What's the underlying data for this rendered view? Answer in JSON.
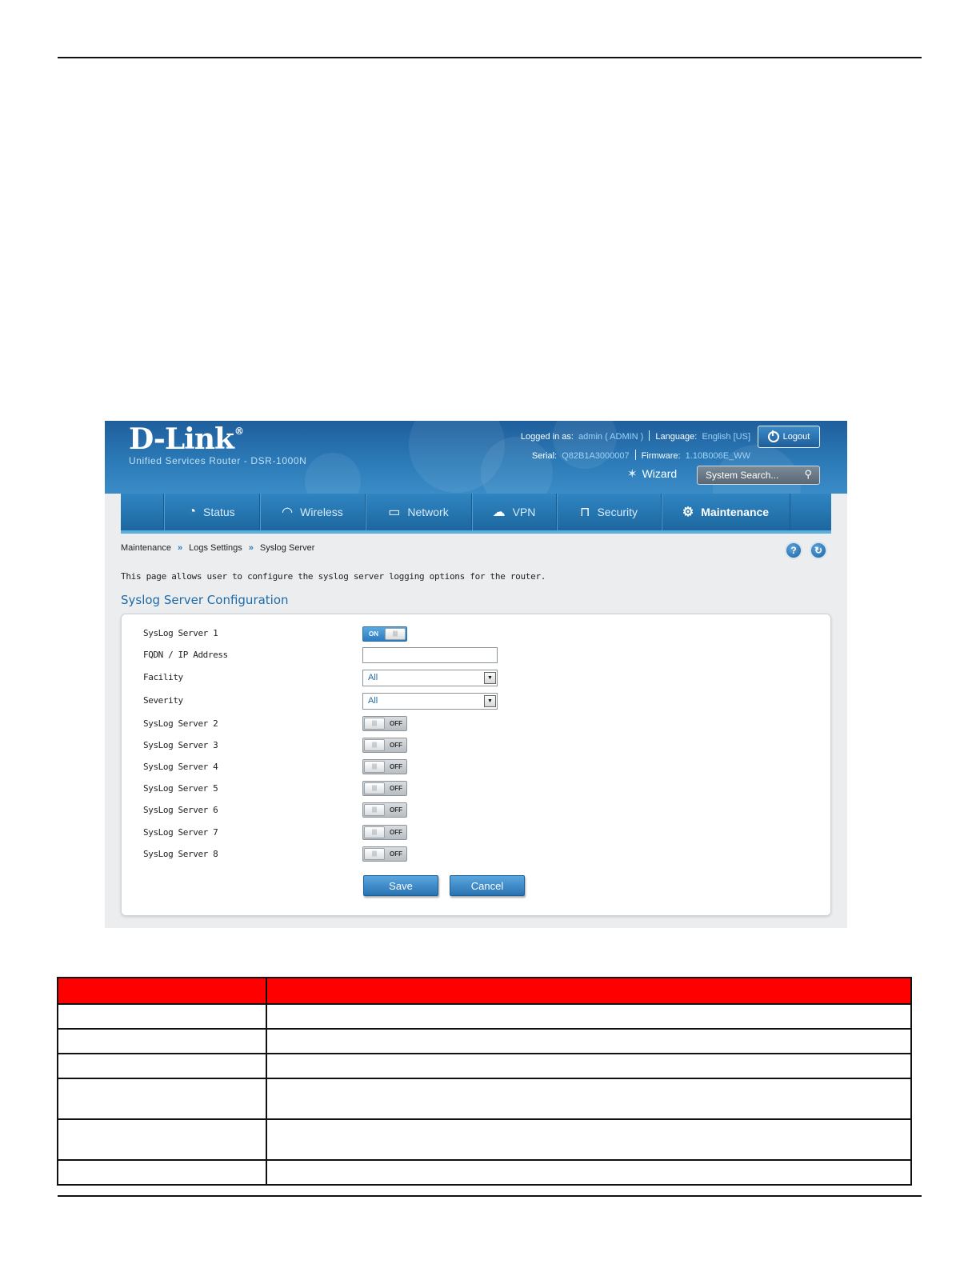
{
  "header": {
    "brand": "D-Link",
    "brand_mark": "®",
    "product": "Unified Services Router - DSR-1000N",
    "logged_in_label": "Logged in as:",
    "user": "admin ( ADMIN )",
    "language_label": "Language:",
    "language": "English [US]",
    "serial_label": "Serial:",
    "serial": "Q82B1A3000007",
    "firmware_label": "Firmware:",
    "firmware": "1.10B006E_WW",
    "logout_label": "Logout",
    "wizard_label": "Wizard",
    "search_placeholder": "System Search..."
  },
  "nav": {
    "tabs": [
      {
        "label": "Status",
        "icon": "gauge-icon"
      },
      {
        "label": "Wireless",
        "icon": "wifi-icon"
      },
      {
        "label": "Network",
        "icon": "monitor-icon"
      },
      {
        "label": "VPN",
        "icon": "cloud-lock-icon"
      },
      {
        "label": "Security",
        "icon": "lock-icon"
      },
      {
        "label": "Maintenance",
        "icon": "gears-icon"
      }
    ],
    "active": "Maintenance"
  },
  "breadcrumb": {
    "items": [
      "Maintenance",
      "Logs Settings",
      "Syslog Server"
    ],
    "separator": "»"
  },
  "page": {
    "help_glyph": "?",
    "refresh_glyph": "↻",
    "intro": "This page allows user to configure the syslog server logging options for the router.",
    "section_title": "Syslog Server Configuration"
  },
  "form": {
    "server1": {
      "label": "SysLog Server 1",
      "state": "ON"
    },
    "fqdn": {
      "label": "FQDN / IP Address",
      "value": ""
    },
    "facility": {
      "label": "Facility",
      "value": "All"
    },
    "severity": {
      "label": "Severity",
      "value": "All"
    },
    "servers": [
      {
        "label": "SysLog Server 2",
        "state": "OFF"
      },
      {
        "label": "SysLog Server 3",
        "state": "OFF"
      },
      {
        "label": "SysLog Server 4",
        "state": "OFF"
      },
      {
        "label": "SysLog Server 5",
        "state": "OFF"
      },
      {
        "label": "SysLog Server 6",
        "state": "OFF"
      },
      {
        "label": "SysLog Server 7",
        "state": "OFF"
      },
      {
        "label": "SysLog Server 8",
        "state": "OFF"
      }
    ],
    "save_label": "Save",
    "cancel_label": "Cancel"
  },
  "colors": {
    "header_blue": "#2b7ab7",
    "link_blue": "#1f6aa8",
    "table_header_red": "#ff0000"
  }
}
